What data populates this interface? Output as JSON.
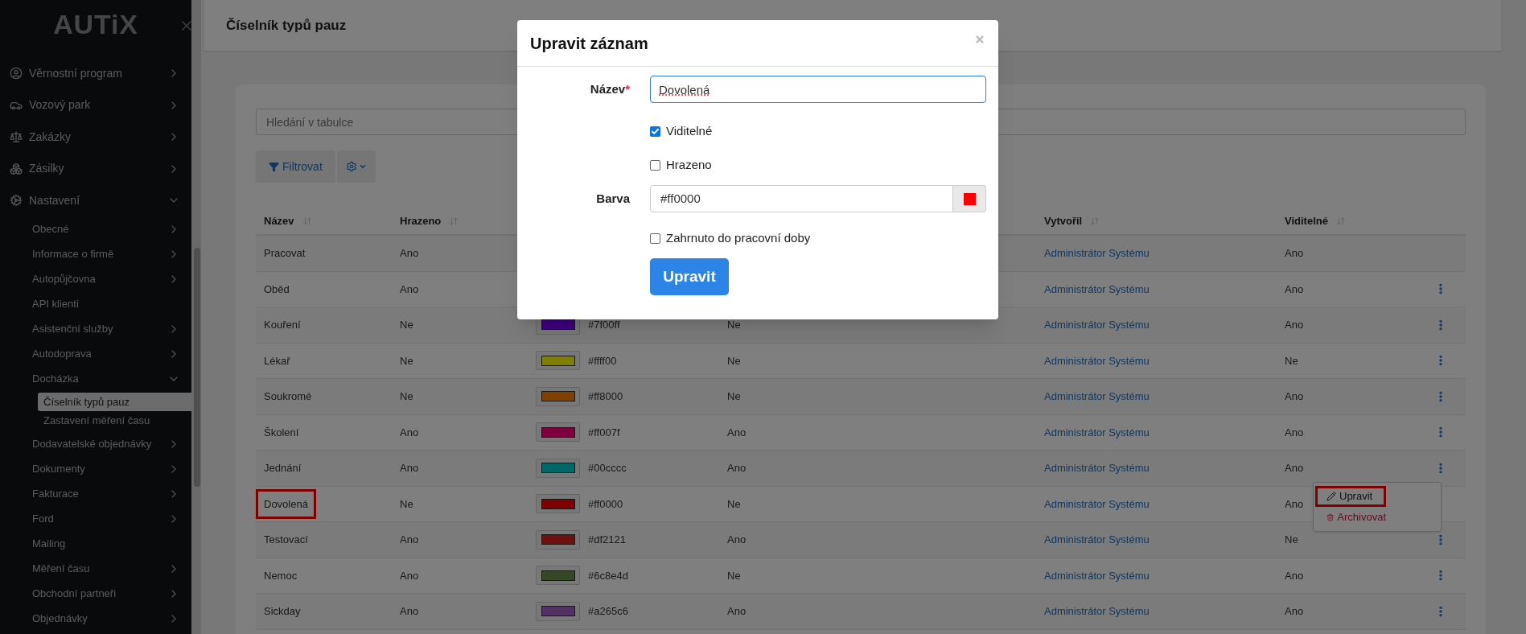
{
  "sidebar": {
    "logo": "AUTiX",
    "items": [
      {
        "label": "Věrnostní program",
        "kind": "group",
        "expanded": false
      },
      {
        "label": "Vozový park",
        "kind": "group",
        "expanded": false
      },
      {
        "label": "Zakázky",
        "kind": "group",
        "expanded": false
      },
      {
        "label": "Zásilky",
        "kind": "group",
        "expanded": false
      },
      {
        "label": "Nastavení",
        "kind": "group",
        "expanded": true,
        "children": [
          {
            "label": "Obecné",
            "kind": "group",
            "expanded": false
          },
          {
            "label": "Informace o firmě",
            "kind": "group",
            "expanded": false
          },
          {
            "label": "Autopůjčovna",
            "kind": "group",
            "expanded": false
          },
          {
            "label": "API klienti",
            "kind": "link"
          },
          {
            "label": "Asistenční služby",
            "kind": "group",
            "expanded": false
          },
          {
            "label": "Autodoprava",
            "kind": "group",
            "expanded": false
          },
          {
            "label": "Docházka",
            "kind": "group",
            "expanded": true,
            "children": [
              {
                "label": "Číselník typů pauz",
                "selected": true
              },
              {
                "label": "Zastavení měření času",
                "selected": false
              }
            ]
          },
          {
            "label": "Dodavatelské objednávky",
            "kind": "group",
            "expanded": false
          },
          {
            "label": "Dokumenty",
            "kind": "group",
            "expanded": false
          },
          {
            "label": "Fakturace",
            "kind": "group",
            "expanded": false
          },
          {
            "label": "Ford",
            "kind": "group",
            "expanded": false
          },
          {
            "label": "Mailing",
            "kind": "link"
          },
          {
            "label": "Měření času",
            "kind": "group",
            "expanded": false
          },
          {
            "label": "Obchodní partneři",
            "kind": "group",
            "expanded": false
          },
          {
            "label": "Objednávky",
            "kind": "group",
            "expanded": false
          }
        ]
      }
    ]
  },
  "page_title": "Číselník typů pauz",
  "search": {
    "placeholder": "Hledání v tabulce"
  },
  "toolbar": {
    "filter_label": "Filtrovat"
  },
  "table": {
    "columns": [
      {
        "label": "Název"
      },
      {
        "label": "Hrazeno"
      },
      {},
      {},
      {
        "label": "Vytvořil"
      },
      {
        "label": "Viditelné"
      }
    ],
    "rows": [
      {
        "name": "Pracovat",
        "paid": "Ano",
        "creator": "Administrátor Systému",
        "visible": "Ano",
        "actions": false,
        "highlighted": false
      },
      {
        "name": "Oběd",
        "paid": "Ano",
        "creator": "Administrátor Systému",
        "visible": "Ano",
        "actions": true,
        "highlighted": false
      },
      {
        "name": "Kouření",
        "paid": "Ne",
        "hex": "#7f00ff",
        "column_4": "Ne",
        "creator": "Administrátor Systému",
        "visible": "Ano",
        "actions": true,
        "highlighted": false,
        "menu_open": false
      },
      {
        "name": "Lékař",
        "paid": "Ne",
        "hex": "#ffff00",
        "column_4": "Ne",
        "creator": "Administrátor Systému",
        "visible": "Ne",
        "actions": true,
        "highlighted": false,
        "menu_open": false
      },
      {
        "name": "Soukromé",
        "paid": "Ne",
        "hex": "#ff8000",
        "column_4": "Ne",
        "creator": "Administrátor Systému",
        "visible": "Ano",
        "actions": true,
        "highlighted": false,
        "menu_open": false
      },
      {
        "name": "Školení",
        "paid": "Ano",
        "hex": "#ff007f",
        "column_4": "Ano",
        "creator": "Administrátor Systému",
        "visible": "Ano",
        "actions": true,
        "highlighted": false,
        "menu_open": false
      },
      {
        "name": "Jednání",
        "paid": "Ano",
        "hex": "#00cccc",
        "column_4": "Ano",
        "creator": "Administrátor Systému",
        "visible": "Ano",
        "actions": true,
        "highlighted": false,
        "menu_open": true
      },
      {
        "name": "Dovolená",
        "paid": "Ne",
        "hex": "#ff0000",
        "column_4": "Ne",
        "creator": "Administrátor Systému",
        "visible": "Ano",
        "actions": false,
        "highlighted": true,
        "menu_open": false
      },
      {
        "name": "Testovací",
        "paid": "Ano",
        "hex": "#df2121",
        "column_4": "Ano",
        "creator": "Administrátor Systému",
        "visible": "Ne",
        "actions": true,
        "highlighted": false,
        "menu_open": false
      },
      {
        "name": "Nemoc",
        "paid": "Ano",
        "hex": "#6c8e4d",
        "column_4": "Ne",
        "creator": "Administrátor Systému",
        "visible": "Ano",
        "actions": true,
        "highlighted": false,
        "menu_open": false
      },
      {
        "name": "Sickday",
        "paid": "Ano",
        "hex": "#a265c6",
        "column_4": "Ano",
        "creator": "Administrátor Systému",
        "visible": "Ano",
        "actions": true,
        "highlighted": false,
        "menu_open": false
      }
    ]
  },
  "row_menu": {
    "items": [
      {
        "label": "Upravit",
        "kind": "edit",
        "highlighted": true
      },
      {
        "label": "Archivovat",
        "kind": "archive",
        "highlighted": false
      }
    ]
  },
  "modal": {
    "title": "Upravit záznam",
    "name_label": "Název",
    "required_mark": "*",
    "name_value": "Dovolená",
    "checkboxes_top": [
      {
        "label": "Viditelné",
        "checked": true
      },
      {
        "label": "Hrazeno",
        "checked": false
      }
    ],
    "color_label": "Barva",
    "color_value": "#ff0000",
    "color": "#ff0000",
    "checkboxes_bottom": [
      {
        "label": "Zahrnuto do pracovní doby",
        "checked": false
      }
    ],
    "submit": "Upravit"
  }
}
